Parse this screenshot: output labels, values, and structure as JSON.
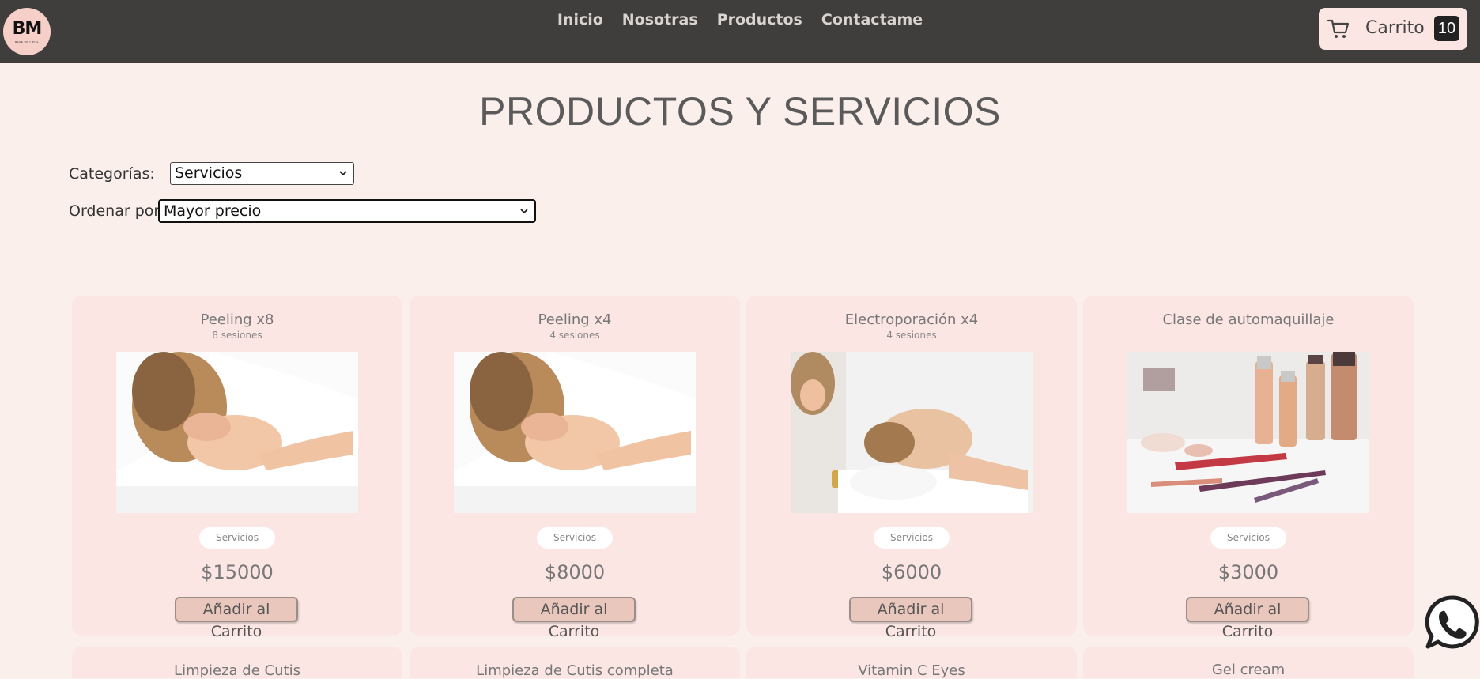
{
  "nav": {
    "logo_text": "BM",
    "logo_subtext": "MAKE UP Y PIEL",
    "links": [
      "Inicio",
      "Nosotras",
      "Productos",
      "Contactame"
    ],
    "cart_label": "Carrito",
    "cart_count": "10"
  },
  "page_title": "PRODUCTOS Y SERVICIOS",
  "filters": {
    "category_label": "Categorías:",
    "category_value": "Servicios",
    "sort_label": "Ordenar por:",
    "sort_value": "Mayor precio"
  },
  "products": [
    {
      "title": "Peeling x8",
      "subtitle": "8 sesiones",
      "category": "Servicios",
      "price": "$15000",
      "button": "Añadir al Carrito"
    },
    {
      "title": "Peeling x4",
      "subtitle": "4 sesiones",
      "category": "Servicios",
      "price": "$8000",
      "button": "Añadir al Carrito"
    },
    {
      "title": "Electroporación x4",
      "subtitle": "4 sesiones",
      "category": "Servicios",
      "price": "$6000",
      "button": "Añadir al Carrito"
    },
    {
      "title": "Clase de automaquillaje",
      "subtitle": "",
      "category": "Servicios",
      "price": "$3000",
      "button": "Añadir al Carrito"
    },
    {
      "title": "Limpieza de Cutis"
    },
    {
      "title": "Limpieza de Cutis completa"
    },
    {
      "title": "Vitamin C Eyes"
    },
    {
      "title": "Gel cream"
    }
  ],
  "colors": {
    "navbar": "#403e3c",
    "background": "#fbefec",
    "card": "#fbe6e3",
    "button": "#e9c7bd",
    "whatsapp": "#222222"
  }
}
